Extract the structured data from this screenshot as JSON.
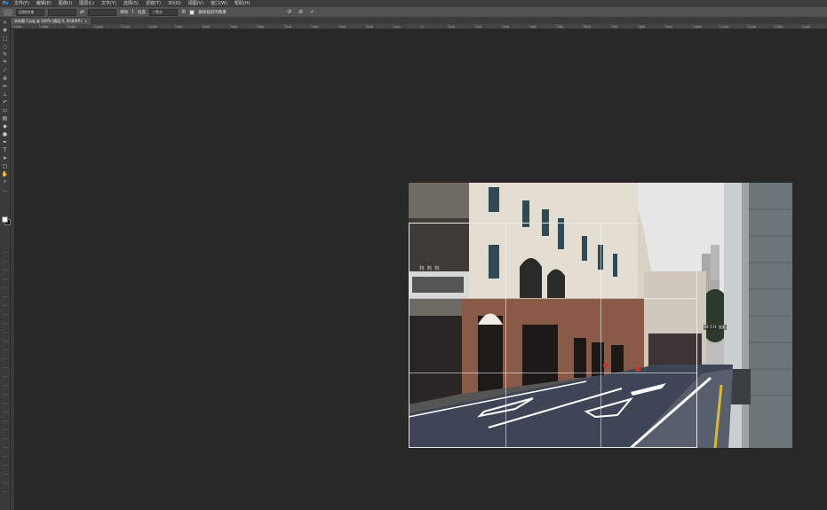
{
  "app": {
    "logo": "Ps"
  },
  "menu": [
    "文件(F)",
    "编辑(E)",
    "图像(I)",
    "图层(L)",
    "文字(Y)",
    "选择(S)",
    "滤镜(T)",
    "3D(D)",
    "视图(V)",
    "窗口(W)",
    "帮助(H)"
  ],
  "options": {
    "ratio_select": "比例/约束",
    "width_value": "",
    "height_value": "",
    "clear_label": "清除",
    "straighten_label": "拉直",
    "overlay_select": "三等分",
    "delete_pixels_label": "删除裁剪的像素",
    "reset_icon": "reset-icon",
    "cancel_icon": "cancel-icon",
    "commit_icon": "commit-icon"
  },
  "tabs": [
    {
      "label": "未标题-1.jpg @ 100% (图层 0, RGB/8#)"
    }
  ],
  "ruler": {
    "ticks": [
      "1500",
      "1400",
      "1300",
      "1200",
      "1100",
      "1000",
      "900",
      "800",
      "700",
      "600",
      "500",
      "400",
      "300",
      "200",
      "100",
      "0",
      "100",
      "200",
      "300",
      "400",
      "500",
      "600",
      "700",
      "800",
      "900",
      "1000",
      "1100",
      "1200",
      "1300",
      "1400"
    ]
  },
  "canvas": {
    "shop_sign": "刘 刘 刘",
    "crop_size_readout": "W: 5 H: 变量"
  },
  "colors": {
    "foreground": "#ffffff",
    "background": "#111111",
    "accent": "#31a8ff"
  }
}
